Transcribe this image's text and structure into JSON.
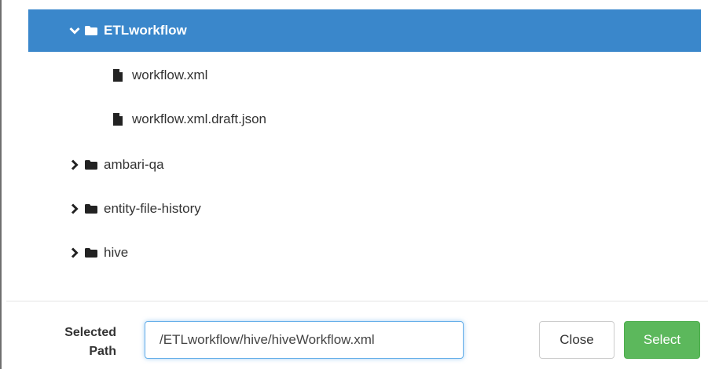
{
  "tree": {
    "items": [
      {
        "label": "ETLworkflow",
        "type": "folder",
        "expanded": true,
        "selected": true,
        "icon": "chevron-down-icon"
      },
      {
        "label": "workflow.xml",
        "type": "file"
      },
      {
        "label": "workflow.xml.draft.json",
        "type": "file"
      },
      {
        "label": "ambari-qa",
        "type": "folder",
        "expanded": false,
        "icon": "chevron-right-icon"
      },
      {
        "label": "entity-file-history",
        "type": "folder",
        "expanded": false,
        "icon": "chevron-right-icon"
      },
      {
        "label": "hive",
        "type": "folder",
        "expanded": false,
        "icon": "chevron-right-icon"
      }
    ]
  },
  "footer": {
    "path_label_line1": "Selected",
    "path_label_line2": "Path",
    "path_value": "/ETLworkflow/hive/hiveWorkflow.xml",
    "close_label": "Close",
    "select_label": "Select"
  },
  "colors": {
    "selected_bg": "#3a87cb",
    "select_button": "#5cb85c"
  }
}
